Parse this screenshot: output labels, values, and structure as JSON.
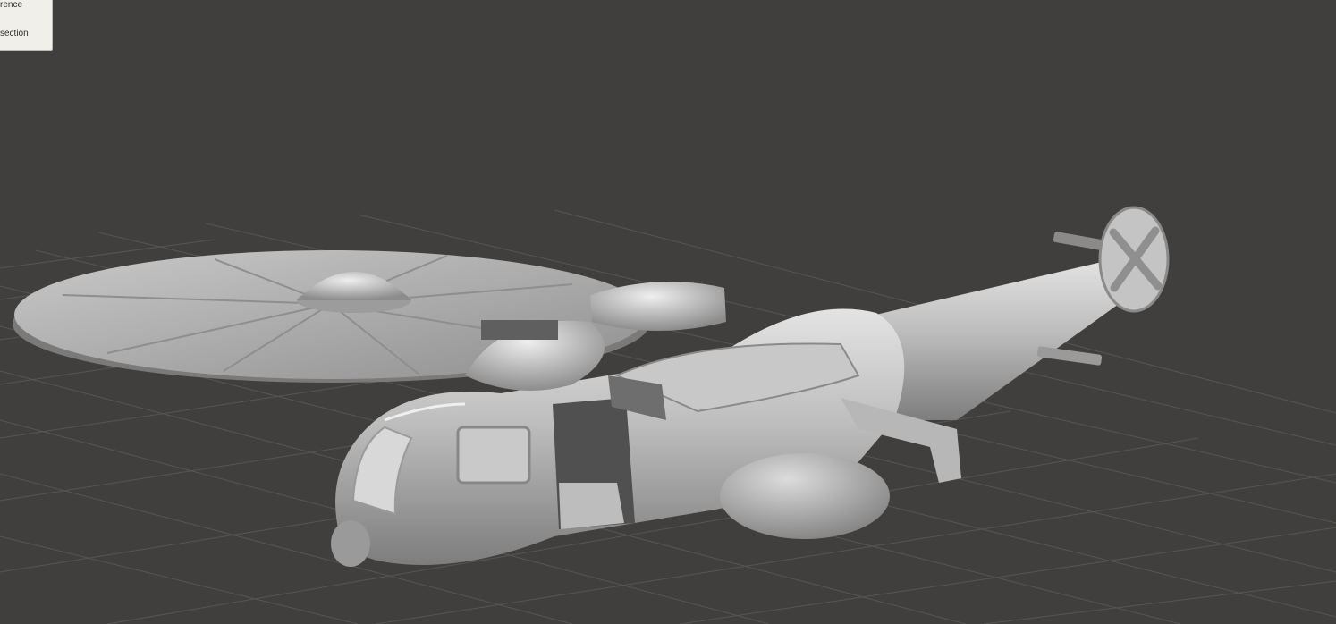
{
  "menu": {
    "items": [
      {
        "label": "rence"
      },
      {
        "label": "section"
      }
    ]
  },
  "scene": {
    "object": "helicopter-model",
    "background_color": "#403f3d",
    "grid_color": "#5a5956",
    "model_color": "#b9b9b9"
  }
}
